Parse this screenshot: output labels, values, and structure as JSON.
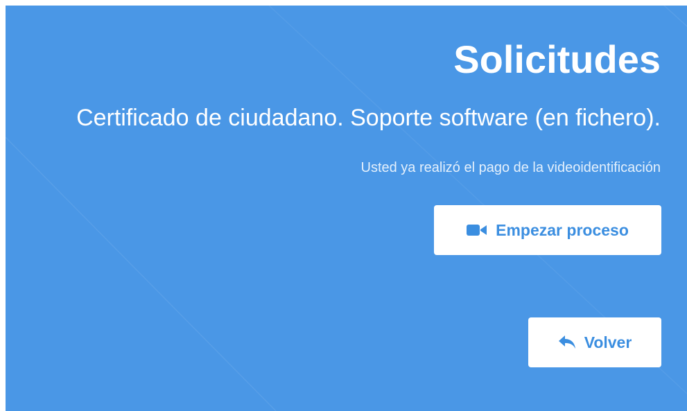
{
  "page": {
    "title": "Solicitudes",
    "subtitle": "Certificado de ciudadano. Soporte software (en fichero).",
    "payment_note": "Usted ya realizó el pago de la videoidentificación"
  },
  "actions": {
    "start_label": "Empezar proceso",
    "start_icon": "video-camera-icon",
    "back_label": "Volver",
    "back_icon": "reply-arrow-icon"
  },
  "colors": {
    "panel_background": "#4a97e6",
    "button_background": "#ffffff",
    "button_text": "#3b8ee0",
    "heading_text": "#ffffff"
  }
}
